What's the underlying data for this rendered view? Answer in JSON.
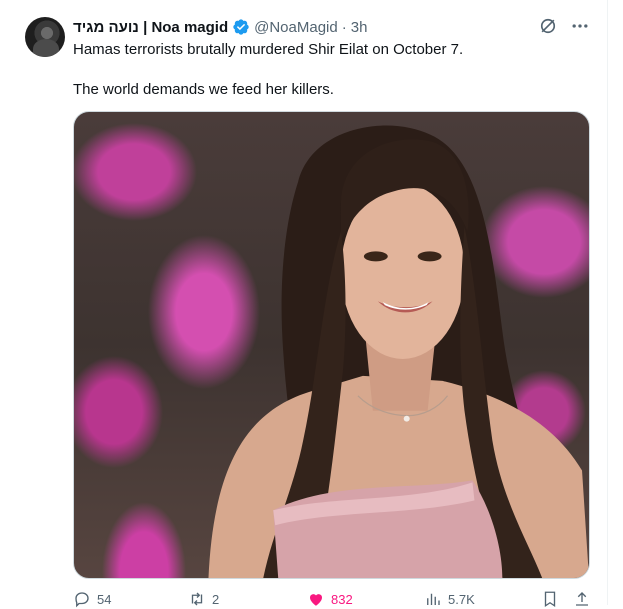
{
  "author": {
    "display_name": "נועה מגיד | Noa magid",
    "handle": "@NoaMagid",
    "separator": "·",
    "time": "3h",
    "verified_color": "#1d9bf0"
  },
  "tweet": {
    "line1": "Hamas terrorists brutally murdered Shir Eilat on October 7.",
    "line2": "The world demands we feed her killers."
  },
  "actions": {
    "replies": "54",
    "retweets": "2",
    "likes": "832",
    "views": "5.7K",
    "like_color": "#f91880"
  },
  "icons": {
    "verified": "verified-badge-icon",
    "grok": "grok-icon",
    "more": "more-icon",
    "reply": "reply-icon",
    "retweet": "retweet-icon",
    "like": "heart-icon",
    "views": "views-icon",
    "bookmark": "bookmark-icon",
    "share": "share-icon"
  }
}
